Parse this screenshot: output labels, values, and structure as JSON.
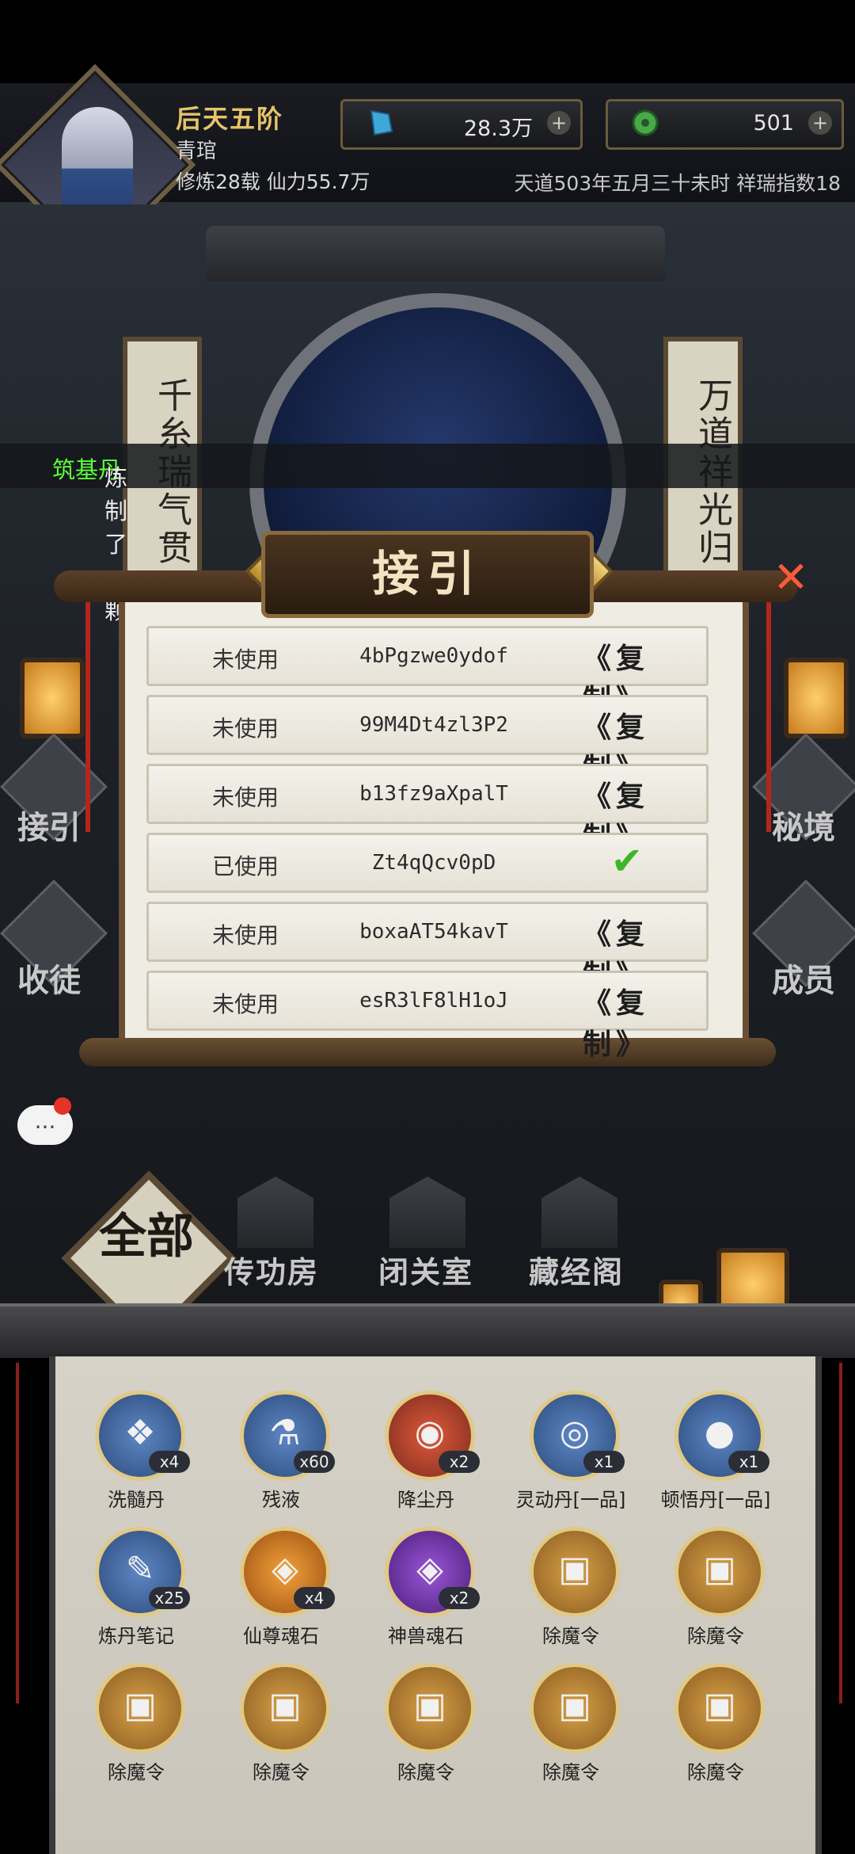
{
  "player": {
    "rank": "后天五阶",
    "name": "青琯",
    "stats": "修炼28载 仙力55.7万"
  },
  "resources": [
    {
      "icon": "blue-crystal-icon",
      "value": "28.3万"
    },
    {
      "icon": "jade-coin-icon",
      "value": "501"
    }
  ],
  "calendar": "天道503年五月三十未时 祥瑞指数18",
  "scene": {
    "couplet_left": "千糸瑞气贯",
    "couplet_right": "万道祥光归"
  },
  "notice": {
    "prefix": "炼制了一颗",
    "highlight": "筑基丹"
  },
  "side_menu": {
    "left_top": "接引",
    "left_bottom": "收徒",
    "right_top": "秘境",
    "right_bottom": "成员"
  },
  "dialog": {
    "title": "接引",
    "copy_label": "复制",
    "rows": [
      {
        "status": "未使用",
        "code": "4bPgzwe0ydof",
        "used": false
      },
      {
        "status": "未使用",
        "code": "99M4Dt4zl3P2",
        "used": false
      },
      {
        "status": "未使用",
        "code": "b13fz9aXpalT",
        "used": false
      },
      {
        "status": "已使用",
        "code": "Zt4qQcv0pD",
        "used": true
      },
      {
        "status": "未使用",
        "code": "boxaAT54kavT",
        "used": false
      },
      {
        "status": "未使用",
        "code": "esR3lF8lH1oJ",
        "used": false
      }
    ]
  },
  "chat": {
    "bubble": "..."
  },
  "tabs": {
    "all": "全部",
    "items": [
      "传功房",
      "闭关室",
      "藏经阁"
    ]
  },
  "inventory": [
    {
      "name": "洗髓丹",
      "count": "x4",
      "style": "blue",
      "glyph": "❖"
    },
    {
      "name": "残液",
      "count": "x60",
      "style": "blue",
      "glyph": "⚗"
    },
    {
      "name": "降尘丹",
      "count": "x2",
      "style": "red",
      "glyph": "◉"
    },
    {
      "name": "灵动丹[一品]",
      "count": "x1",
      "style": "blue",
      "glyph": "◎"
    },
    {
      "name": "顿悟丹[一品]",
      "count": "x1",
      "style": "blue",
      "glyph": "●"
    },
    {
      "name": "炼丹笔记",
      "count": "x25",
      "style": "blue",
      "glyph": "✎"
    },
    {
      "name": "仙尊魂石",
      "count": "x4",
      "style": "orange",
      "glyph": "◈"
    },
    {
      "name": "神兽魂石",
      "count": "x2",
      "style": "purple",
      "glyph": "◈"
    },
    {
      "name": "除魔令",
      "count": "",
      "style": "gold",
      "glyph": "▣"
    },
    {
      "name": "除魔令",
      "count": "",
      "style": "gold",
      "glyph": "▣"
    },
    {
      "name": "除魔令",
      "count": "",
      "style": "gold",
      "glyph": "▣"
    },
    {
      "name": "除魔令",
      "count": "",
      "style": "gold",
      "glyph": "▣"
    },
    {
      "name": "除魔令",
      "count": "",
      "style": "gold",
      "glyph": "▣"
    },
    {
      "name": "除魔令",
      "count": "",
      "style": "gold",
      "glyph": "▣"
    },
    {
      "name": "除魔令",
      "count": "",
      "style": "gold",
      "glyph": "▣"
    }
  ]
}
